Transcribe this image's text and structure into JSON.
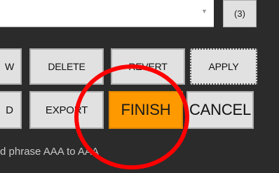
{
  "count_label": "(3)",
  "buttons_row1": {
    "partial_left": "W",
    "delete": "DELETE",
    "revert": "REVERT",
    "apply": "APPLY"
  },
  "buttons_row2": {
    "partial_left": "D",
    "export": "EXPORT",
    "finish": "FINISH",
    "cancel": "CANCEL"
  },
  "status_text": "d phrase AAA to AAA",
  "colors": {
    "finish_accent": "#ff9900",
    "annotation_circle": "#ff0000"
  }
}
